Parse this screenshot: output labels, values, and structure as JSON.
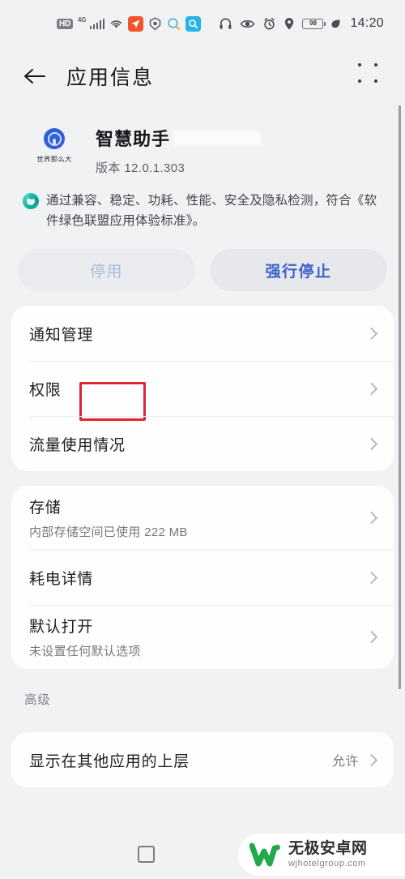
{
  "statusbar": {
    "hd_label": "HD",
    "network_label": "4G",
    "icons_left": [
      "hd-badge-icon",
      "network-4g-icon",
      "signal-bars-icon",
      "wifi-icon",
      "navigation-app-icon",
      "shield-app-icon",
      "search-bubble-icon",
      "search-app-icon"
    ],
    "icons_right": [
      "headphones-icon",
      "eye-comfort-icon",
      "alarm-icon",
      "location-icon",
      "battery-icon",
      "power-saving-icon"
    ],
    "battery_level": "98",
    "time": "14:20"
  },
  "header": {
    "back_icon": "back-arrow-icon",
    "title": "应用信息",
    "menu_icon": "grid-menu-icon"
  },
  "app": {
    "icon_name": "app-logo-icon",
    "icon_caption": "世界那么大",
    "name": "智慧助手",
    "name_redacted": true,
    "version_label": "版本",
    "version_value": "12.0.1.303"
  },
  "certification": {
    "icon_name": "green-alliance-badge-icon",
    "text": "通过兼容、稳定、功耗、性能、安全及隐私检测，符合《软件绿色联盟应用体验标准》。"
  },
  "actions": {
    "disable_label": "停用",
    "force_stop_label": "强行停止",
    "highlight_color": "#e0262b",
    "primary_color": "#3d62c9"
  },
  "cards": [
    {
      "rows": [
        {
          "title": "通知管理",
          "sub": "",
          "value": ""
        },
        {
          "title": "权限",
          "sub": "",
          "value": ""
        },
        {
          "title": "流量使用情况",
          "sub": "",
          "value": ""
        }
      ]
    },
    {
      "rows": [
        {
          "title": "存储",
          "sub": "内部存储空间已使用 222 MB",
          "value": ""
        },
        {
          "title": "耗电详情",
          "sub": "",
          "value": ""
        },
        {
          "title": "默认打开",
          "sub": "未设置任何默认选项",
          "value": ""
        }
      ]
    }
  ],
  "advanced": {
    "section_title": "高级",
    "rows": [
      {
        "title": "显示在其他应用的上层",
        "sub": "",
        "value": "允许"
      }
    ]
  },
  "navbar": {
    "recents_icon": "square-recents-icon",
    "home_icon": "circle-home-icon",
    "watermark_cn": "无极安卓网",
    "watermark_en": "wjhotelgroup.com",
    "watermark_color": "#21a94c"
  }
}
